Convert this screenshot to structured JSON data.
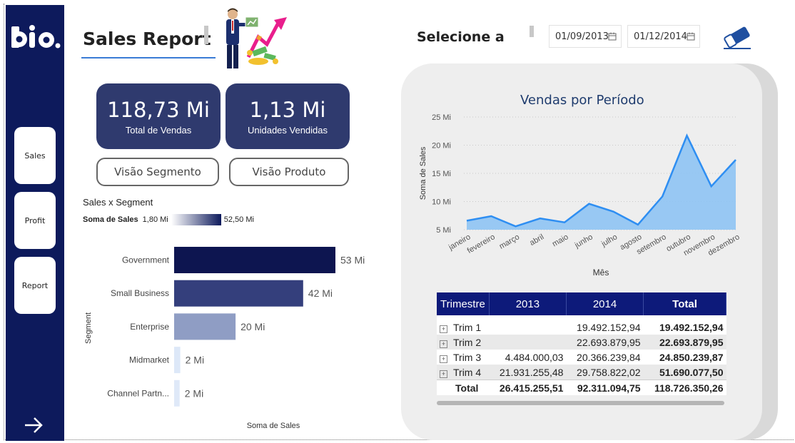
{
  "nav": {
    "items": [
      {
        "label": "Sales"
      },
      {
        "label": "Profit"
      },
      {
        "label": "Report"
      }
    ]
  },
  "header": {
    "title": "Sales Report",
    "filter_label": "Selecione a",
    "date_start": "01/09/2013",
    "date_end": "01/12/2014"
  },
  "kpis": [
    {
      "value": "118,73 Mi",
      "label": "Total de Vendas"
    },
    {
      "value": "1,13 Mi",
      "label": "Unidades Vendidas"
    }
  ],
  "buttons": {
    "segment_view": "Visão Segmento",
    "product_view": "Visão Produto"
  },
  "colors": {
    "sidebar": "#0d1a5c",
    "kpi_card": "#2f3a6e",
    "table_header": "#0d1a7a",
    "area_fill": "#8ec3f3",
    "area_line": "#2e8ef2"
  },
  "chart_data": [
    {
      "type": "bar",
      "title": "Sales x Segment",
      "color_legend": {
        "label": "Soma de Sales",
        "min": "1,80 Mi",
        "max": "52,50 Mi"
      },
      "xlabel": "Soma de Sales",
      "ylabel": "Segment",
      "categories": [
        "Government",
        "Small Business",
        "Enterprise",
        "Midmarket",
        "Channel Partn..."
      ],
      "values": [
        52.5,
        42,
        20,
        2,
        1.8
      ],
      "data_labels": [
        "53 Mi",
        "42 Mi",
        "20 Mi",
        "2 Mi",
        "2 Mi"
      ],
      "colors": [
        "#0d1550",
        "#343f7c",
        "#8f9dc4",
        "#dde8f8",
        "#dfe9f8"
      ]
    },
    {
      "type": "area",
      "title": "Vendas por Período",
      "xlabel": "Mês",
      "ylabel": "Soma de Sales",
      "ylim": [
        5,
        25
      ],
      "yticks": [
        "5 Mi",
        "10 Mi",
        "15 Mi",
        "20 Mi",
        "25 Mi"
      ],
      "grid": true,
      "categories": [
        "janeiro",
        "fevereiro",
        "março",
        "abril",
        "maio",
        "junho",
        "julho",
        "agosto",
        "setembro",
        "outubro",
        "novembro",
        "dezembro"
      ],
      "values": [
        6.6,
        7.4,
        5.6,
        7.0,
        6.3,
        9.6,
        8.2,
        5.9,
        10.9,
        21.7,
        12.7,
        17.4
      ]
    }
  ],
  "table": {
    "headers": [
      "Trimestre",
      "2013",
      "2014",
      "Total"
    ],
    "rows": [
      {
        "label": "Trim 1",
        "y2013": "",
        "y2014": "19.492.152,94",
        "total": "19.492.152,94"
      },
      {
        "label": "Trim 2",
        "y2013": "",
        "y2014": "22.693.879,95",
        "total": "22.693.879,95"
      },
      {
        "label": "Trim 3",
        "y2013": "4.484.000,03",
        "y2014": "20.366.239,84",
        "total": "24.850.239,87"
      },
      {
        "label": "Trim 4",
        "y2013": "21.931.255,48",
        "y2014": "29.758.822,02",
        "total": "51.690.077,50"
      }
    ],
    "total_row": {
      "label": "Total",
      "y2013": "26.415.255,51",
      "y2014": "92.311.094,75",
      "total": "118.726.350,26"
    }
  }
}
